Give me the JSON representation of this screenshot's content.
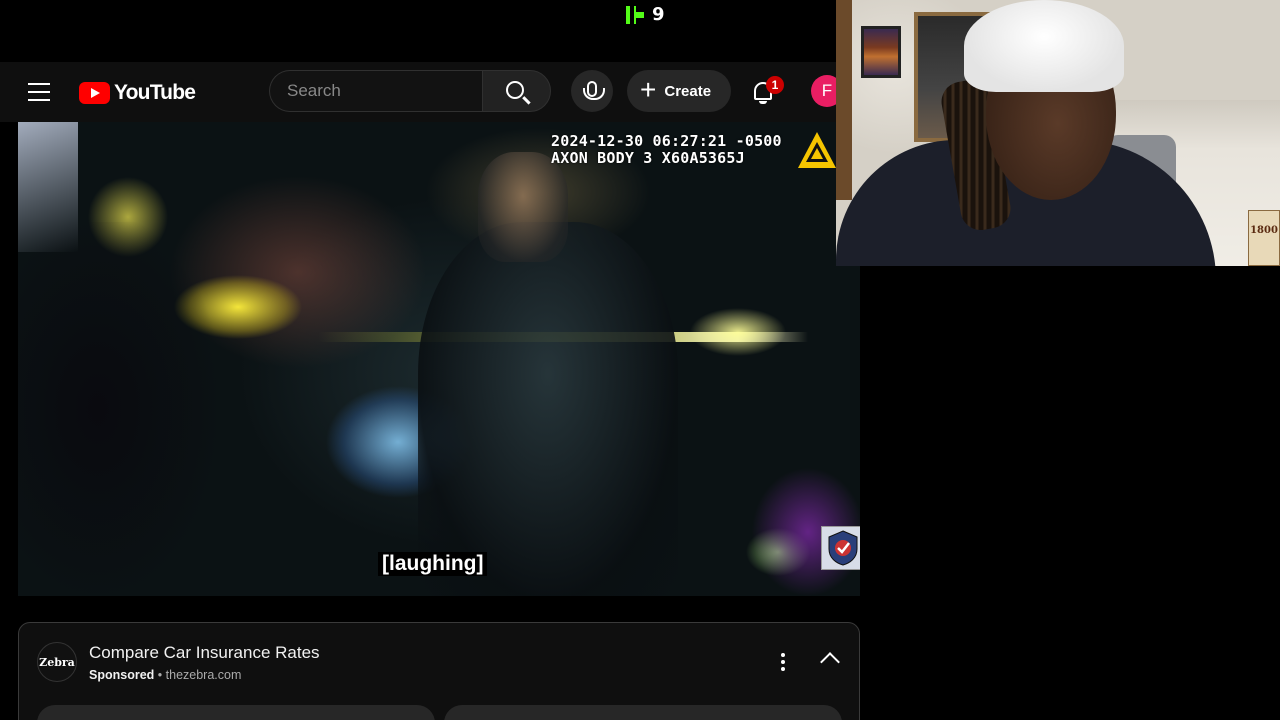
{
  "stream": {
    "viewer_count": "9",
    "brand_color": "#53fc18"
  },
  "header": {
    "logo_text": "YouTube",
    "search_placeholder": "Search",
    "create_label": "Create",
    "notification_count": "1",
    "avatar_initial": "F",
    "icons": [
      "menu-icon",
      "youtube-logo",
      "search-icon",
      "mic-icon",
      "plus-icon",
      "bell-icon"
    ]
  },
  "video": {
    "timestamp_line1": "2024-12-30 06:27:21 -0500",
    "timestamp_line2": "AXON BODY 3 X60A5365J",
    "caption": "[laughing]"
  },
  "ad": {
    "logo_text": "Zebra",
    "title": "Compare Car Insurance Rates",
    "sponsored_label": "Sponsored",
    "separator": "•",
    "domain": "thezebra.com"
  },
  "webcam": {
    "box_label": "1800"
  },
  "colors": {
    "youtube_red": "#ff0000",
    "header_bg": "#0f0f0f",
    "avatar_bg": "#e91e63",
    "badge_bg": "#cc0000"
  }
}
